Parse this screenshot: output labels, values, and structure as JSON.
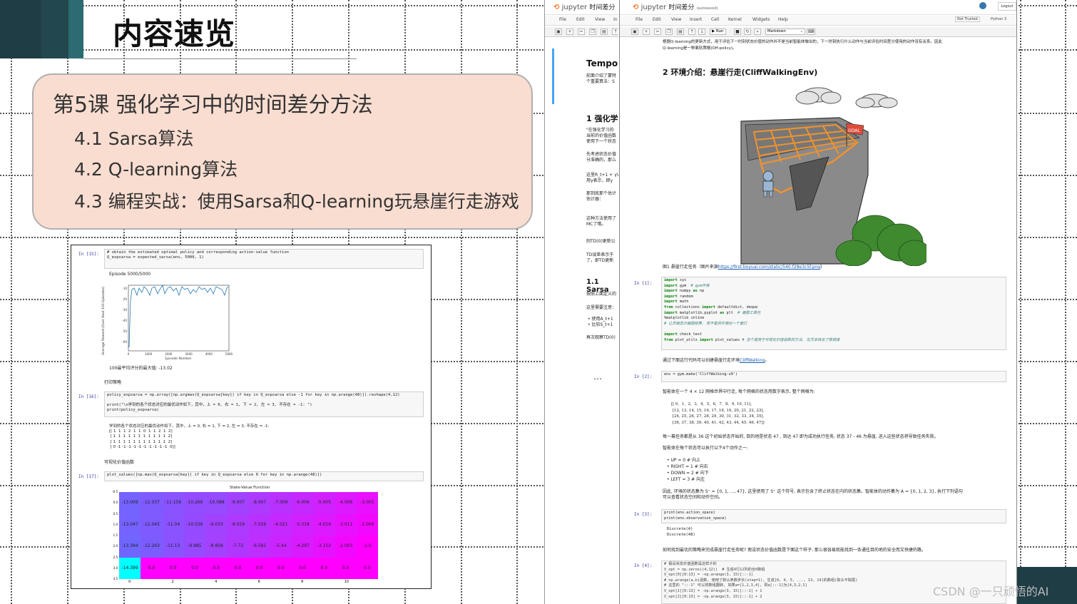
{
  "slide": {
    "title": "内容速览",
    "lesson_title": "第5课 强化学习中的时间差分方法",
    "items": [
      "4.1 Sarsa算法",
      "4.2 Q-learning算法",
      "4.3 编程实战：使用Sarsa和Q-learning玩悬崖行走游戏"
    ],
    "ellipsis": "…"
  },
  "left_notebook": {
    "cell1_prompt": "In  [15]:",
    "cell1_code": "# obtain the estimated optimal policy and corresponding action-value function\nQ_expsarsa = expected_sarsa(env, 5000, 1)",
    "episode_text": "Episode 5000/5000",
    "plot_ylabel": "Average Reward (Over Next 100 Episodes)",
    "plot_xlabel": "Episode Number",
    "plot_xticks": [
      "0",
      "1000",
      "2000",
      "3000",
      "4000",
      "5000"
    ],
    "plot_yticks": [
      "-10",
      "-20",
      "-30",
      "-40",
      "-50",
      "-60"
    ],
    "best_text": "100最平均评分的最大值: -13.02",
    "print_policy_label": "打印策略",
    "cell2_prompt": "In  [16]:",
    "cell2_code": "policy_expsarsa = np.array([np.argmax(Q_expsarsa[key]) if key in Q_expsarsa else -1 for key in np.arange(48)]).reshape(4,12)\n\nprint(\"\\n学到的各个状态对应的最优动作如下，其中，上 = 0, 右 = 1, 下 = 2, 左 = 3, 不存在 = -1: \")\nprint(policy_expsarsa)",
    "cell2_output": "学到的各个状态对应的最优动作如下，其中，上 = 0, 右 = 1, 下 = 2, 左 = 3, 不存在 = -1:\n[[ 1  1  1  2  1  1  0  1  1  2  1  2]\n [ 1  1  1  1  1  1  1  1  1  1  1  2]\n [ 1  1  1  1  1  1  1  1  1  1  1  2]\n [ 0 -1 -1 -1 -1 -1 -1 -1 -1 -1 -1  0]]",
    "visual_label": "可视化价值函数",
    "cell3_prompt": "In  [17]:",
    "cell3_code": "plot_values([np.max(Q_expsarsa[key]) if key in Q_expsarsa else 0 for key in np.arange(48)])",
    "heatmap_title": "State-Value Function",
    "heatmap_rows": [
      [
        "-13.009",
        "-12.037",
        "-11.159",
        "-10.266",
        "-10.088",
        "-9.007",
        "-8.007",
        "-7.009",
        "-6.006",
        "-5.005",
        "-4.006",
        "-3.005"
      ],
      [
        "-13.047",
        "-12.045",
        "-11.04",
        "-10.036",
        "-9.033",
        "-8.029",
        "-7.026",
        "-6.021",
        "-5.018",
        "-4.016",
        "-3.011",
        "-2.006"
      ],
      [
        "-13.394",
        "-12.263",
        "-11.13",
        "-9.985",
        "-8.858",
        "-7.72",
        "-6.581",
        "-5.44",
        "-4.297",
        "-3.152",
        "-2.003",
        "-1.0"
      ],
      [
        "-14.399",
        "0.0",
        "0.0",
        "0.0",
        "0.0",
        "0.0",
        "0.0",
        "0.0",
        "0.0",
        "0.0",
        "0.0",
        "0.0"
      ]
    ],
    "heat_xticks": [
      "0",
      "2",
      "4",
      "6",
      "8",
      "10"
    ],
    "heat_yticks": [
      "-0.5",
      "0.0",
      "0.5",
      "1.0",
      "1.5",
      "2.0",
      "2.5",
      "3.0",
      "3.5"
    ]
  },
  "jupyter_back": {
    "logo": "jupyter",
    "title": "时间差分",
    "menus": [
      "File",
      "Edit",
      "View",
      "In"
    ],
    "heading": "Tempor",
    "intro": "前面介绍了蒙特\n个重要算法：S",
    "section1": "1 强化学",
    "p1": "\"在强化学习的\n当前的价值函数\n使用下一个状态",
    "p2": "先考虑状态价值\n分准确的，那么",
    "p3": "这里R_t+1 + γV\n用γ表示，即y",
    "p4": "那到底那个估计\n估计器：",
    "p5": "这种方法使用了\nMC了哦。",
    "p6": "则TD(0)更新公",
    "p7": "TD误差表示于\n了，即TD更新",
    "section11": "1.1 Sarsa",
    "p8": "按照上面定义的",
    "p9": "这里需要注意：",
    "p10": "• 使用A_t+1\n• 比较S_t+1",
    "p11": "再次观察TD(0)"
  },
  "jupyter_front": {
    "logo": "jupyter",
    "title": "时间差分",
    "autosaved": "(autosaved)",
    "logout": "Logout",
    "menus": [
      "File",
      "Edit",
      "View",
      "Insert",
      "Cell",
      "Kernel",
      "Widgets",
      "Help"
    ],
    "trusted": "Not Trusted",
    "kernel": "Python 3",
    "run_label": "Run",
    "celltype": "Markdown",
    "top_text": "根据Q-learning的更新方式，用于评估下一时刻状态价值的动作并不是当前智能体做出的，下一时刻执行什么动作与当前评估时间差分使用的动作没有关系。因此\nQ-learning是一种离轨策略(Off-policy)。",
    "section2": "2 环境介绍：悬崖行走(CliffWalkingEnv)",
    "goal_flag": "GOAL",
    "fig_caption": "图1 悬崖行走任务（图片来源",
    "fig_link": "https://first.boyuai.com/static/540.f28e3c5f.png",
    "fig_caption_end": ")",
    "cell1_prompt": "In  [1]:",
    "cell1_code": [
      {
        "t": "kw",
        "v": "import"
      },
      {
        "t": "txt",
        "v": " sys\n"
      },
      {
        "t": "kw",
        "v": "import"
      },
      {
        "t": "txt",
        "v": " gym  "
      },
      {
        "t": "cm",
        "v": "# gym环境"
      },
      {
        "t": "txt",
        "v": "\n"
      },
      {
        "t": "kw",
        "v": "import"
      },
      {
        "t": "txt",
        "v": " numpy "
      },
      {
        "t": "kw",
        "v": "as"
      },
      {
        "t": "txt",
        "v": " np\n"
      },
      {
        "t": "kw",
        "v": "import"
      },
      {
        "t": "txt",
        "v": " random\n"
      },
      {
        "t": "kw",
        "v": "import"
      },
      {
        "t": "txt",
        "v": " math\n"
      },
      {
        "t": "kw",
        "v": "from"
      },
      {
        "t": "txt",
        "v": " collections "
      },
      {
        "t": "kw",
        "v": "import"
      },
      {
        "t": "txt",
        "v": " defaultdict, deque\n"
      },
      {
        "t": "kw",
        "v": "import"
      },
      {
        "t": "txt",
        "v": " matplotlib.pyplot "
      },
      {
        "t": "kw",
        "v": "as"
      },
      {
        "t": "txt",
        "v": " plt  "
      },
      {
        "t": "cm",
        "v": "# 画图工具包"
      },
      {
        "t": "txt",
        "v": "\n%matplotlib inline\n"
      },
      {
        "t": "cm",
        "v": "# 让页面显示画图结果, 而不是另外弹出一个窗口"
      },
      {
        "t": "txt",
        "v": "\n\n"
      },
      {
        "t": "kw",
        "v": "import"
      },
      {
        "t": "txt",
        "v": " check_test\n"
      },
      {
        "t": "kw",
        "v": "from"
      },
      {
        "t": "txt",
        "v": " plot_utils "
      },
      {
        "t": "kw",
        "v": "import"
      },
      {
        "t": "txt",
        "v": " plot_values "
      },
      {
        "t": "cm",
        "v": "# 这个是用于可视化价值函数的方法, 在文本给出了数链接"
      }
    ],
    "after1_text": "通过下面这行代码可以创建悬崖行走环境",
    "after1_link": "CliffWalking",
    "after1_end": "。",
    "cell2_prompt": "In  [2]:",
    "cell2_code": "env = gym.make('CliffWalking-v0')",
    "grid_intro": "智能体在一个 4 × 12 网格世界中行走, 每个网格的状态用数字表示, 整个网格为:",
    "grid_text": "[[ 0,  1,  2,  3,  4,  5,  6,  7,  8,  9, 10, 11],\n [12, 13, 14, 15, 16, 17, 18, 19, 20, 21, 22, 23],\n [24, 25, 26, 27, 28, 29, 30, 31, 32, 33, 34, 35],\n [36, 37, 38, 39, 40, 41, 42, 43, 44, 45, 46, 47]]",
    "episode_text": "每一幕任务都是从 36 这个初始状态开始的, 目的地是状态 47 , 到达 47 即为成功执行任务, 状态 37 - 46 为悬崖, 进入这些状态将导致任务失败。",
    "actions_intro": "智能体在每个状态可以执行以下4个动作之一:",
    "actions": "• UP = 0 # 向上\n• RIGHT = 1 # 向右\n• DOWN = 2 # 向下\n• LEFT = 3 # 向左",
    "state_space_text": "因此, 环境的状态集为 S⁺ = {0, 1, ..., 47}, 这里使用了 S⁺ 这个符号, 表示包含了终止状态在内的状态集。智能体的动作集为 A = {0, 1, 2, 3}, 执行下列语句\n可以查看状态空间和动作空间。",
    "cell3_prompt": "In  [3]:",
    "cell3_code": "print(env.action_space)\nprint(env.observation_space)",
    "cell3_output": "Discrete(4)\nDiscrete(48)",
    "question_text": "如何找到最优的策略来完成悬崖行走任务呢? 假设状态价值函数是下面这个样子, 那么很容易就能找到一条通往目的地的安全而又快捷的路。",
    "cell4_prompt": "In  [4]:",
    "cell4_code": "# 假设状态价值函数是这样子的\nV_opt = np.zeros((4,12))  # 生成4行12列的全0数组\nV_opt[0][0:13] = -np.arange(3, 15)[::-1]\n# np.arange(a,b)函数, 使用了默认参数步长(step=1), 生成[0, 4, 5, ..., 13, 14]的数组(取头不取尾)\n# 这里的 \"::-1\" 可以将数组翻转, 如果a=[1,2,3,4], 则a[::-1]为[4,3,2,1]\nV_opt[1][0:13] = -np.arange(3, 15)[::-1] + 1\nV_opt[2][0:13] = -np.arange(3, 15)[::-1] + 2"
  },
  "watermark": "CSDN @一只顽悟的AI",
  "colors": {
    "lesson_box_bg": "#f9ddd0",
    "header_dark": "#1f3d45",
    "heat_purple": "#7a3cff",
    "heat_magenta": "#ff00ff",
    "heat_cyan": "#00ffff",
    "jupyter_orange": "#f37726",
    "prompt_blue": "#303f9f"
  }
}
